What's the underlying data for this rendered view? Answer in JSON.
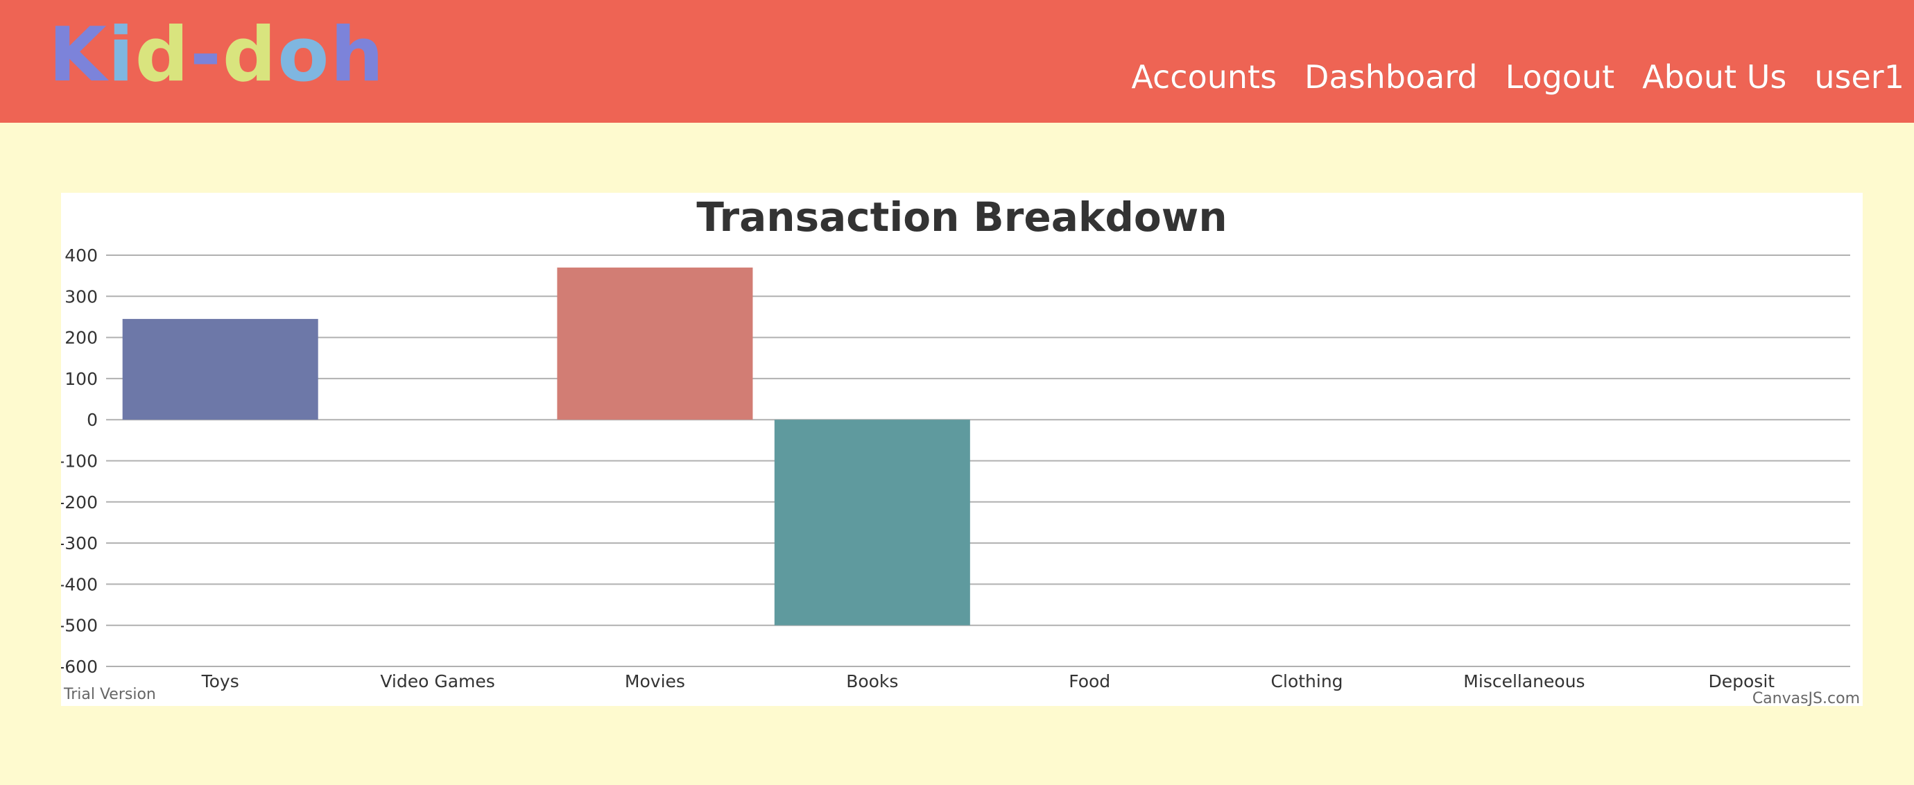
{
  "header": {
    "logo": {
      "letters": [
        "K",
        "i",
        "d",
        "-",
        "d",
        "o",
        "h"
      ],
      "colors": [
        "#7c83da",
        "#7fb6e0",
        "#d9e47e",
        "#7c83da",
        "#d9e47e",
        "#7fb6e0",
        "#7c83da"
      ]
    },
    "nav": [
      {
        "label": "Accounts",
        "name": "nav-accounts"
      },
      {
        "label": "Dashboard",
        "name": "nav-dashboard"
      },
      {
        "label": "Logout",
        "name": "nav-logout"
      },
      {
        "label": "About Us",
        "name": "nav-about-us"
      },
      {
        "label": "user1",
        "name": "nav-user"
      }
    ],
    "background": "#ee6454"
  },
  "page": {
    "background": "#fefacf"
  },
  "chart_data": {
    "type": "bar",
    "title": "Transaction Breakdown",
    "categories": [
      "Toys",
      "Video Games",
      "Movies",
      "Books",
      "Food",
      "Clothing",
      "Miscellaneous",
      "Deposit"
    ],
    "values": [
      245,
      0,
      370,
      -500,
      0,
      0,
      0,
      0
    ],
    "bar_colors": [
      "#6d78a8",
      "#c2b86f",
      "#d27d74",
      "#5f9a9e",
      "#9aa86a",
      "#8f88b0",
      "#d39a6a",
      "#7fa6c4"
    ],
    "ylim": [
      -600,
      400
    ],
    "yticks": [
      400,
      300,
      200,
      100,
      0,
      -100,
      -200,
      -300,
      -400,
      -500,
      -600
    ],
    "grid": true,
    "legend": "none",
    "xlabel": "",
    "ylabel": "",
    "footer_left": "Trial Version",
    "footer_right": "CanvasJS.com"
  }
}
